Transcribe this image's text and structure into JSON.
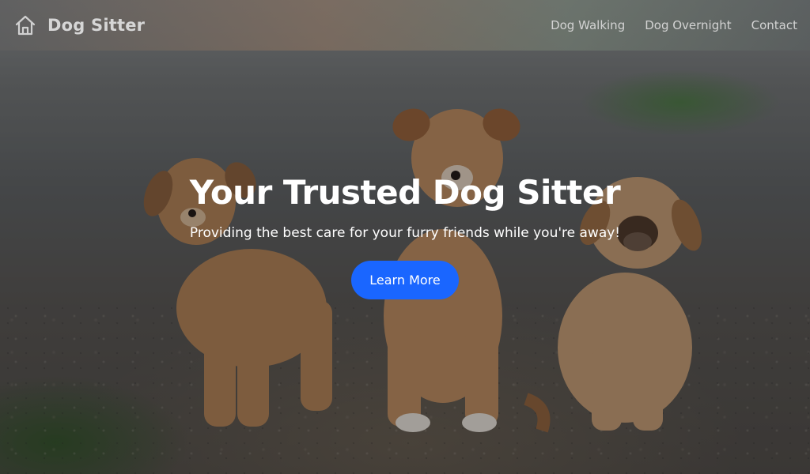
{
  "brand": {
    "icon": "house-icon",
    "name": "Dog Sitter"
  },
  "nav": {
    "links": [
      {
        "label": "Dog Walking"
      },
      {
        "label": "Dog Overnight"
      },
      {
        "label": "Contact"
      }
    ]
  },
  "hero": {
    "title": "Your Trusted Dog Sitter",
    "subtitle": "Providing the best care for your furry friends while you're away!",
    "cta_label": "Learn More",
    "background_image": "three-puppies-photo"
  },
  "colors": {
    "accent": "#1a66ff",
    "title_text": "#ffffff",
    "nav_text": "#d3d3d3"
  }
}
